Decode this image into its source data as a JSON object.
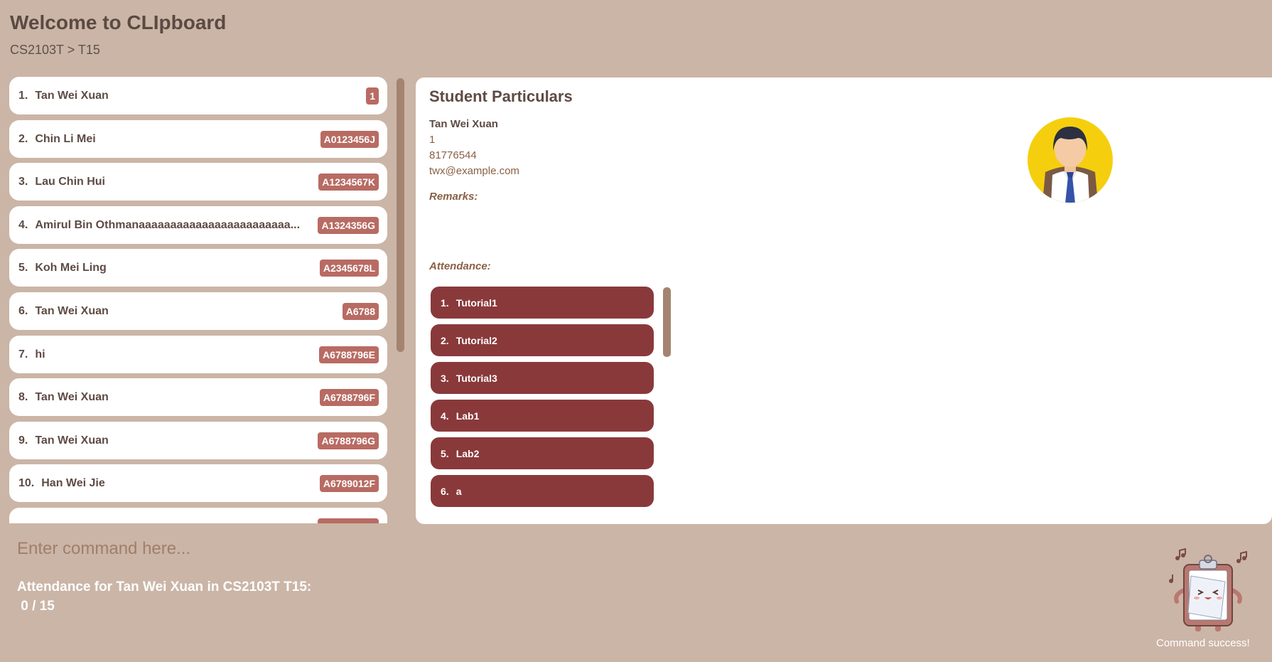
{
  "app": {
    "title": "Welcome to CLIpboard",
    "breadcrumb": "CS2103T > T15"
  },
  "students": [
    {
      "index": "1.",
      "name": "Tan Wei Xuan",
      "id": "1"
    },
    {
      "index": "2.",
      "name": "Chin Li Mei",
      "id": "A0123456J"
    },
    {
      "index": "3.",
      "name": "Lau Chin Hui",
      "id": "A1234567K"
    },
    {
      "index": "4.",
      "name": "Amirul Bin Othmanaaaaaaaaaaaaaaaaaaaaaaaa...",
      "id": "A1324356G"
    },
    {
      "index": "5.",
      "name": "Koh Mei Ling",
      "id": "A2345678L"
    },
    {
      "index": "6.",
      "name": "Tan Wei Xuan",
      "id": "A6788"
    },
    {
      "index": "7.",
      "name": "hi",
      "id": "A6788796E"
    },
    {
      "index": "8.",
      "name": "Tan Wei Xuan",
      "id": "A6788796F"
    },
    {
      "index": "9.",
      "name": "Tan Wei Xuan",
      "id": "A6788796G"
    },
    {
      "index": "10.",
      "name": "Han Wei Jie",
      "id": "A6789012F"
    }
  ],
  "details": {
    "heading": "Student Particulars",
    "name": "Tan Wei Xuan",
    "student_id": "1",
    "phone": "81776544",
    "email": "twx@example.com",
    "remarks_label": "Remarks:",
    "attendance_label": "Attendance:",
    "attendance": [
      {
        "index": "1.",
        "session": "Tutorial1"
      },
      {
        "index": "2.",
        "session": "Tutorial2"
      },
      {
        "index": "3.",
        "session": "Tutorial3"
      },
      {
        "index": "4.",
        "session": "Lab1"
      },
      {
        "index": "5.",
        "session": "Lab2"
      },
      {
        "index": "6.",
        "session": "a"
      }
    ]
  },
  "command": {
    "placeholder": "Enter command here...",
    "value": ""
  },
  "result": {
    "line1": "Attendance for Tan Wei Xuan in CS2103T T15:",
    "line2": " 0 / 15"
  },
  "status": {
    "text": "Command success!",
    "icon": "clipboard-mascot-icon"
  },
  "colors": {
    "background": "#cbb5a7",
    "badge": "#b86b63",
    "attendance_item": "#8a393b",
    "scrollbar": "#a38471",
    "text_dark": "#5e4b44"
  }
}
